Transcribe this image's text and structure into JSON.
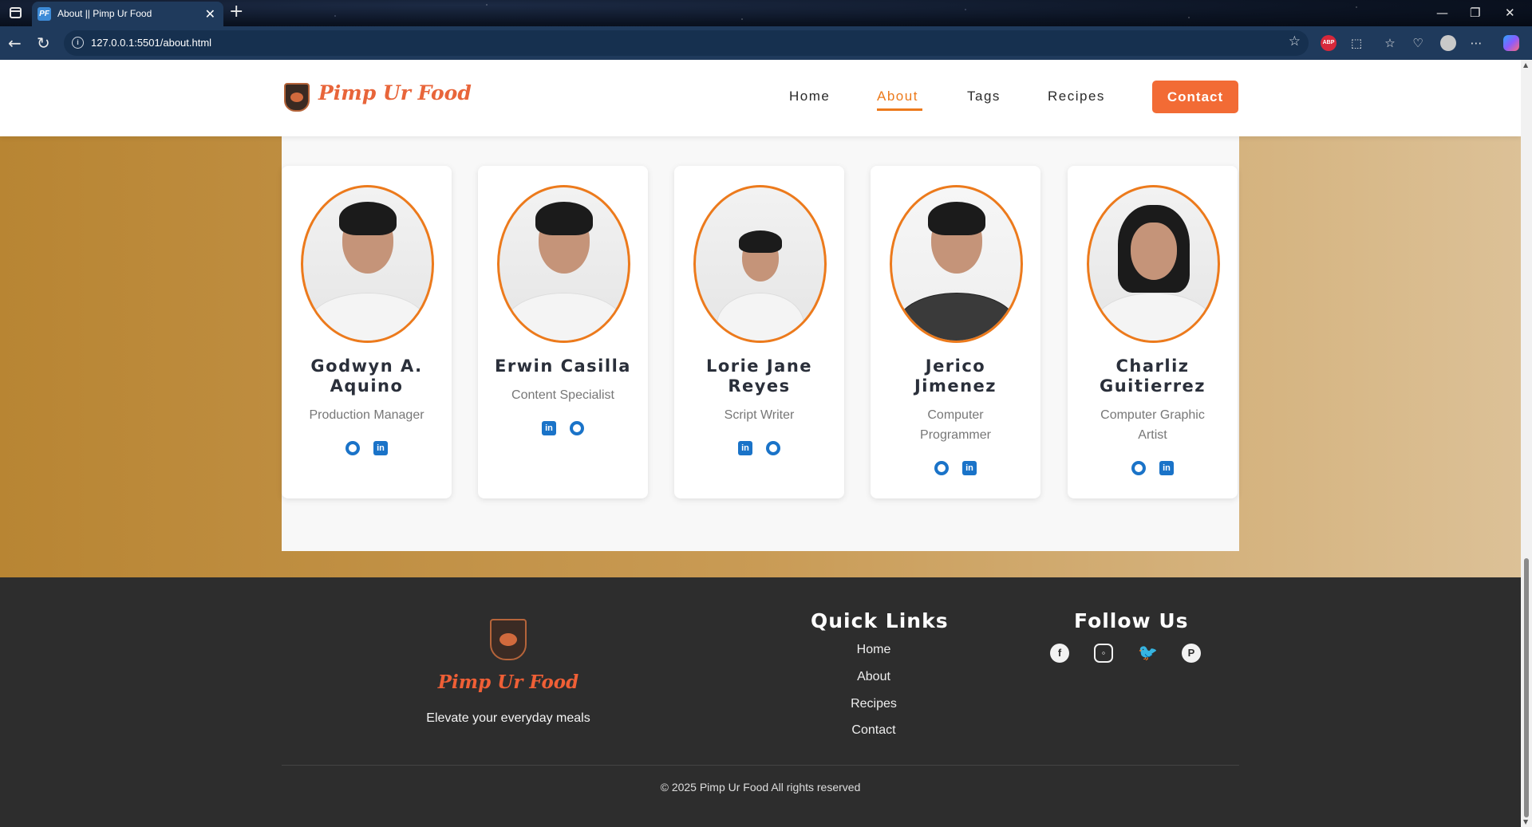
{
  "browser": {
    "tab_title": "About || Pimp Ur Food",
    "tab_favicon": "PF",
    "url": "127.0.0.1:5501/about.html",
    "icons": [
      "back-icon",
      "reload-icon",
      "info-icon",
      "star-icon",
      "adblock-icon",
      "extensions-icon",
      "favorites-icon",
      "health-icon",
      "profile-icon",
      "more-icon",
      "copilot-icon"
    ]
  },
  "header": {
    "logo_text": "Pimp Ur Food",
    "nav": {
      "home": "Home",
      "about": "About",
      "tags": "Tags",
      "recipes": "Recipes",
      "contact": "Contact"
    },
    "active_nav": "about",
    "accent_color": "#ec7a1c",
    "contact_color": "#f26b35"
  },
  "team": [
    {
      "name_line1": "Godwyn A.",
      "name_line2": "Aquino",
      "role_line1": "Production Manager",
      "role_line2": "",
      "links": [
        "github",
        "linkedin"
      ]
    },
    {
      "name_line1": "Erwin Casilla",
      "name_line2": "",
      "role_line1": "Content Specialist",
      "role_line2": "",
      "links": [
        "linkedin",
        "github"
      ]
    },
    {
      "name_line1": "Lorie Jane",
      "name_line2": "Reyes",
      "role_line1": "Script Writer",
      "role_line2": "",
      "links": [
        "linkedin",
        "github"
      ]
    },
    {
      "name_line1": "Jerico",
      "name_line2": "Jimenez",
      "role_line1": "Computer",
      "role_line2": "Programmer",
      "links": [
        "github",
        "linkedin"
      ]
    },
    {
      "name_line1": "Charliz",
      "name_line2": "Guitierrez",
      "role_line1": "Computer Graphic",
      "role_line2": "Artist",
      "links": [
        "github",
        "linkedin"
      ]
    }
  ],
  "footer": {
    "logo_text": "Pimp Ur Food",
    "tagline": "Elevate your everyday meals",
    "quick_links_title": "Quick Links",
    "quick_links": [
      "Home",
      "About",
      "Recipes",
      "Contact"
    ],
    "follow_title": "Follow Us",
    "social_icons": [
      "facebook-icon",
      "instagram-icon",
      "twitter-icon",
      "pinterest-icon"
    ],
    "copyright": "© 2025 Pimp Ur Food All rights reserved"
  }
}
